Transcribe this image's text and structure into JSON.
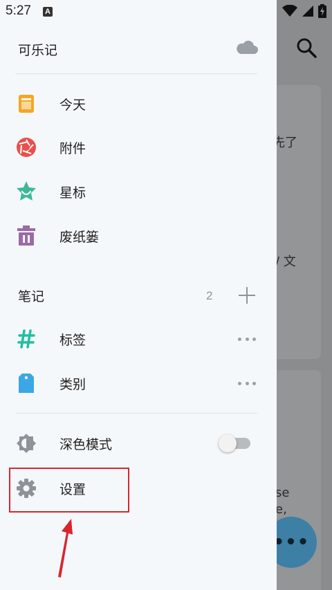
{
  "status_bar": {
    "time": "5:27",
    "app_badge": "A"
  },
  "background": {
    "text_fragments": [
      "先了",
      "/ 文",
      "se",
      "e,"
    ],
    "fab_label": "•••"
  },
  "drawer": {
    "app_name": "可乐记",
    "nav": [
      {
        "label": "今天",
        "icon": "calendar-icon",
        "color": "#f6a623"
      },
      {
        "label": "附件",
        "icon": "camera-aperture-icon",
        "color": "#e8504a"
      },
      {
        "label": "星标",
        "icon": "star-badge-icon",
        "color": "#3fb89a"
      },
      {
        "label": "废纸篓",
        "icon": "trash-icon",
        "color": "#9b6aa7"
      }
    ],
    "notes_section": {
      "title": "笔记",
      "count": "2"
    },
    "note_items": [
      {
        "label": "标签",
        "icon": "hashtag-icon",
        "color": "#1fbf9f"
      },
      {
        "label": "类别",
        "icon": "tag-icon",
        "color": "#3aa7e6"
      }
    ],
    "dark_mode": {
      "label": "深色模式",
      "enabled": false
    },
    "settings": {
      "label": "设置"
    }
  },
  "colors": {
    "drawer_bg": "#f5f8fb",
    "annotation": "#d9252e"
  }
}
